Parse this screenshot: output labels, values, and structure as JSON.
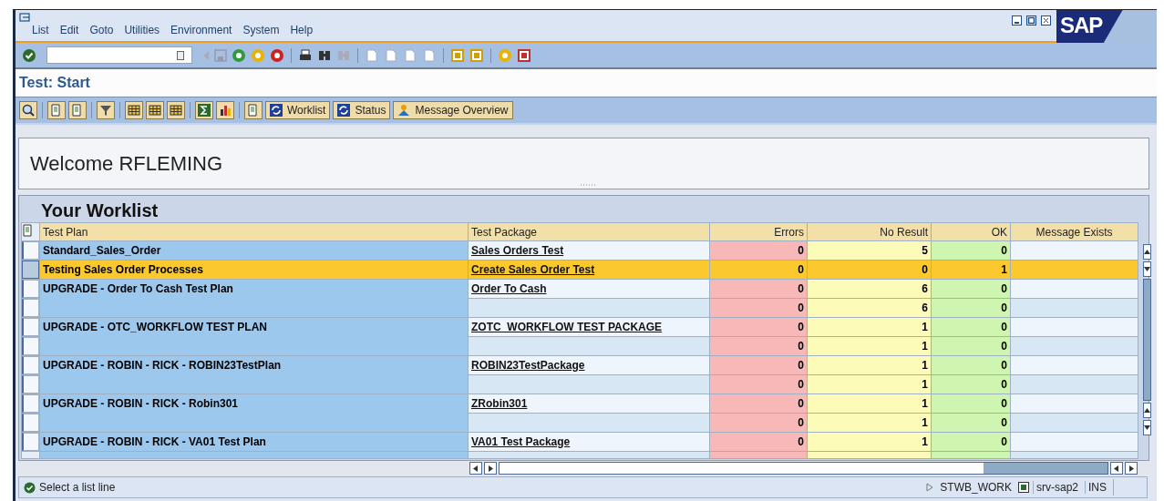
{
  "menu": [
    "List",
    "Edit",
    "Goto",
    "Utilities",
    "Environment",
    "System",
    "Help"
  ],
  "logo": "SAP",
  "title": "Test: Start",
  "app_toolbar": [
    "Worklist",
    "Status",
    "Message Overview"
  ],
  "welcome": "Welcome RFLEMING",
  "worklist": {
    "title": "Your Worklist",
    "columns": [
      "Test Plan",
      "Test Package",
      "Errors",
      "No Result",
      "OK",
      "Message Exists"
    ],
    "groups": [
      {
        "plan": "Standard_Sales_Order",
        "package": "Sales Orders Test",
        "selected": false,
        "results": [
          {
            "errors": "0",
            "no_result": "5",
            "ok": "0"
          }
        ]
      },
      {
        "plan": "Testing Sales Order Processes",
        "package": "Create Sales Order Test",
        "selected": true,
        "results": [
          {
            "errors": "0",
            "no_result": "0",
            "ok": "1"
          }
        ]
      },
      {
        "plan": "UPGRADE - Order To Cash Test Plan",
        "package": "Order To Cash",
        "selected": false,
        "results": [
          {
            "errors": "0",
            "no_result": "6",
            "ok": "0"
          },
          {
            "errors": "0",
            "no_result": "6",
            "ok": "0"
          }
        ]
      },
      {
        "plan": "UPGRADE - OTC_WORKFLOW TEST PLAN",
        "package": "ZOTC_WORKFLOW TEST PACKAGE",
        "selected": false,
        "results": [
          {
            "errors": "0",
            "no_result": "1",
            "ok": "0"
          },
          {
            "errors": "0",
            "no_result": "1",
            "ok": "0"
          }
        ]
      },
      {
        "plan": "UPGRADE - ROBIN - RICK - ROBIN23TestPlan",
        "package": "ROBIN23TestPackage",
        "selected": false,
        "results": [
          {
            "errors": "0",
            "no_result": "1",
            "ok": "0"
          },
          {
            "errors": "0",
            "no_result": "1",
            "ok": "0"
          }
        ]
      },
      {
        "plan": "UPGRADE - ROBIN - RICK - Robin301",
        "package": "ZRobin301",
        "selected": false,
        "results": [
          {
            "errors": "0",
            "no_result": "1",
            "ok": "0"
          },
          {
            "errors": "0",
            "no_result": "1",
            "ok": "0"
          }
        ]
      },
      {
        "plan": "UPGRADE - ROBIN - RICK - VA01 Test Plan",
        "package": "VA01 Test Package",
        "selected": false,
        "results": [
          {
            "errors": "0",
            "no_result": "1",
            "ok": "0"
          }
        ]
      }
    ]
  },
  "status_bar": {
    "message": "Select a list line",
    "transaction": "STWB_WORK",
    "server": "srv-sap2",
    "mode": "INS"
  }
}
